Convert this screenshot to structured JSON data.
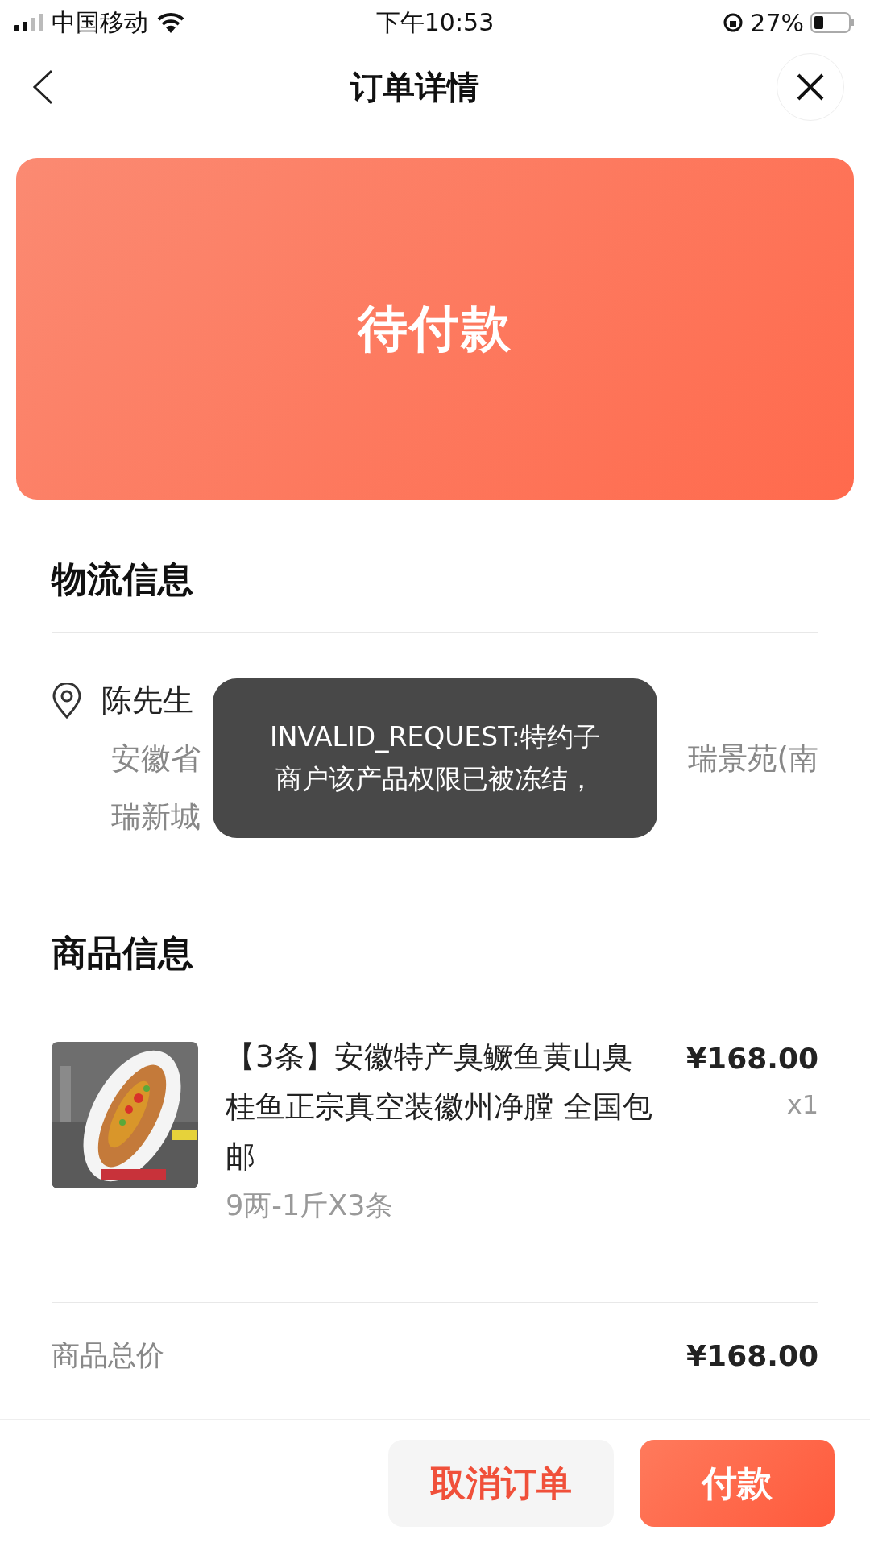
{
  "status_bar": {
    "carrier": "中国移动",
    "time": "下午10:53",
    "battery": "27%"
  },
  "nav": {
    "title": "订单详情"
  },
  "banner": {
    "status": "待付款"
  },
  "logistics": {
    "heading": "物流信息",
    "name": "陈先生",
    "address_start": "安徽省",
    "address_end": "瑞景苑(南",
    "address_line_2": "瑞新城"
  },
  "toast": {
    "lines": [
      "INVALID_REQUEST:特约子",
      "商户该产品权限已被冻结，"
    ]
  },
  "goods": {
    "heading": "商品信息",
    "items": [
      {
        "kind": "picture",
        "title": "【3条】安徽特产臭鳜鱼黄山臭桂鱼正宗真空装徽州净膛 全国包邮",
        "spec": "9两-1斤X3条",
        "price": "¥168.00",
        "quantity": "x1"
      }
    ],
    "total_label": "商品总价",
    "total": "¥168.00"
  },
  "actions": [
    {
      "label": "取消订单",
      "kind": "secondary"
    },
    {
      "label": "付款",
      "kind": "primary"
    }
  ]
}
